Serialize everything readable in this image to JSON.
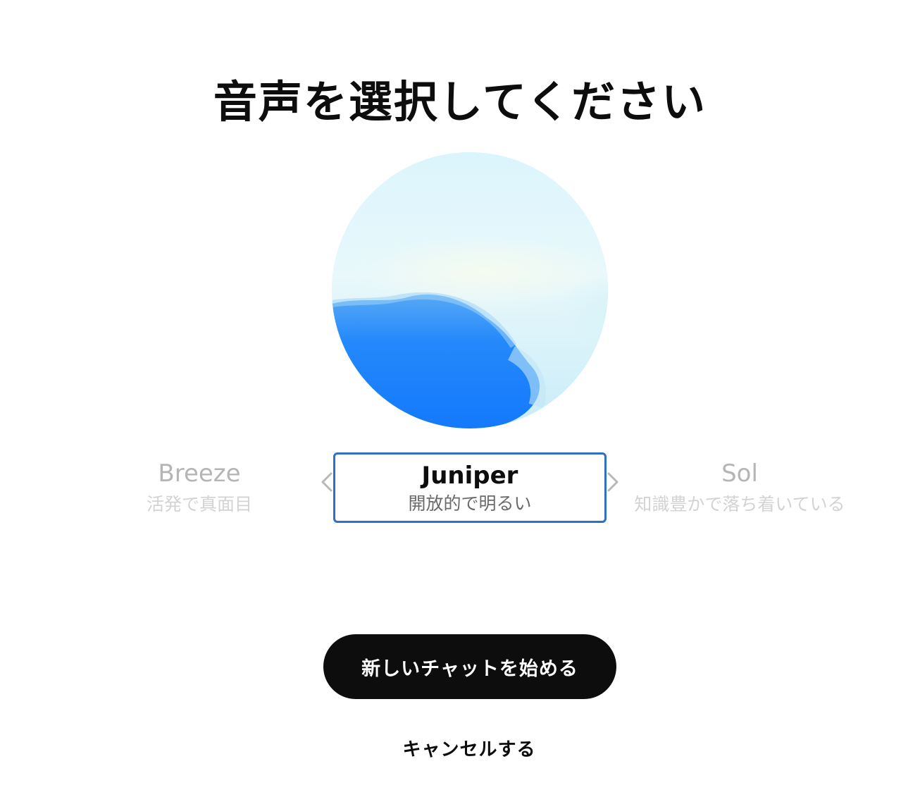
{
  "page": {
    "title": "音声を選択してください"
  },
  "voices": {
    "previous": {
      "name": "Breeze",
      "description": "活発で真面目"
    },
    "selected": {
      "name": "Juniper",
      "description": "開放的で明るい"
    },
    "next": {
      "name": "Sol",
      "description": "知識豊かで落ち着いている"
    }
  },
  "actions": {
    "start_label": "新しいチャットを始める",
    "cancel_label": "キャンセルする"
  },
  "colors": {
    "selection_border": "#2f6fc4",
    "orb_blue": "#1a82fb",
    "orb_sky": "#dcf5fb",
    "button_bg": "#0d0d0d"
  },
  "icons": {
    "prev": "chevron-left-icon",
    "next": "chevron-right-icon"
  }
}
